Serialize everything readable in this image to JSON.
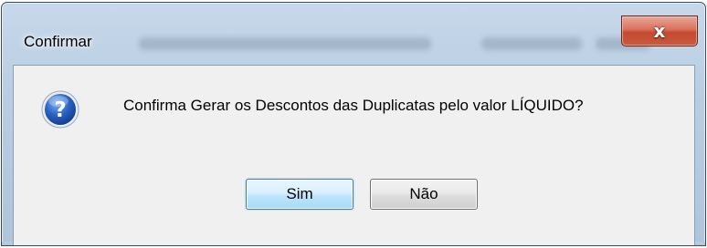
{
  "dialog": {
    "title": "Confirmar",
    "close_glyph": "x",
    "icon": "question-icon",
    "message": "Confirma Gerar os Descontos das Duplicatas pelo valor LÍQUIDO?",
    "buttons": {
      "yes_label": "Sim",
      "no_label": "Não"
    }
  },
  "colors": {
    "close_button": "#c44a31",
    "default_button_border": "#3c7fb1",
    "client_background": "#f0f0f0",
    "icon_blue": "#1f4fa8"
  }
}
